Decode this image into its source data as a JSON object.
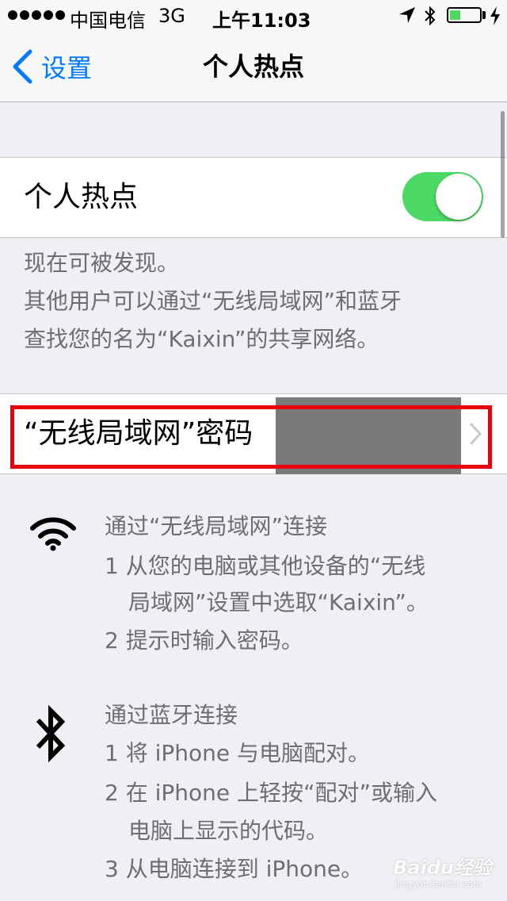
{
  "status_bar": {
    "carrier": "中国电信",
    "network": "3G",
    "time": "上午11:03",
    "battery_level": 0.35,
    "icons": [
      "signal-dots-icon",
      "location-arrow-icon",
      "bluetooth-icon",
      "battery-icon",
      "charging-bolt-icon"
    ]
  },
  "nav": {
    "back_label": "设置",
    "title": "个人热点"
  },
  "hotspot": {
    "label": "个人热点",
    "enabled": true
  },
  "discovery": {
    "line1": "现在可被发现。",
    "line2": "其他用户可以通过“无线局域网”和蓝牙",
    "line3": "查找您的名为“Kaixin”的共享网络。"
  },
  "password": {
    "label": "“无线局域网”密码"
  },
  "wifi_section": {
    "heading": "通过“无线局域网”连接",
    "step1_line1": "1 从您的电脑或其他设备的“无线",
    "step1_line2": "局域网”设置中选取“Kaixin”。",
    "step2": "2 提示时输入密码。"
  },
  "bt_section": {
    "heading": "通过蓝牙连接",
    "step1": "1 将 iPhone 与电脑配对。",
    "step2_line1": "2 在 iPhone 上轻按“配对”或输入",
    "step2_line2": "电脑上显示的代码。",
    "step3": "3 从电脑连接到 iPhone。"
  },
  "watermark": {
    "text": "Baidu经验",
    "sub": "jingyan.baidu.com"
  },
  "colors": {
    "accent": "#007aff",
    "toggle_on": "#4cd964",
    "highlight": "#e8000d",
    "footer_text": "#6d6d72"
  }
}
